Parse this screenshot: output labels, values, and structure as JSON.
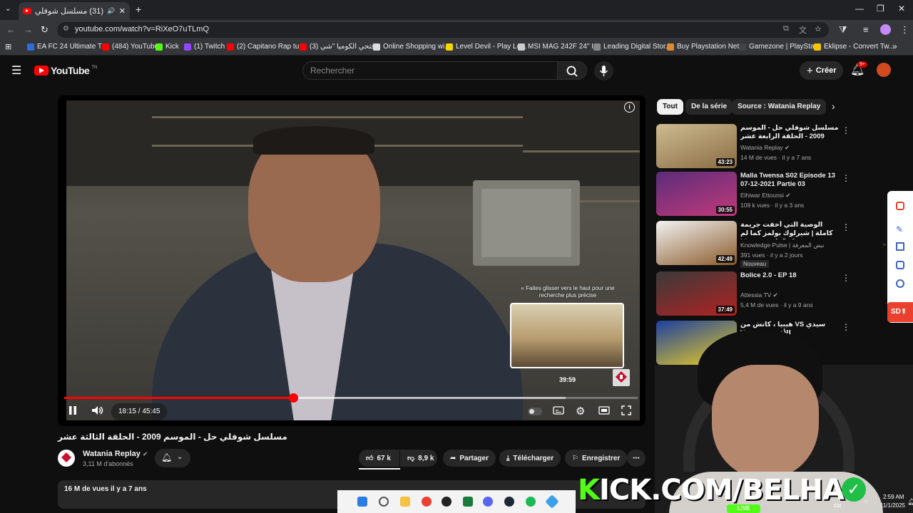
{
  "browser": {
    "tab_title": "(31) مسلسل شوفلي حل - ال...",
    "new_tab": "+",
    "url": "youtube.com/watch?v=RiXeO7uTLmQ",
    "bookmarks": [
      {
        "label": "EA FC 24 Ultimate T...",
        "color": "#2d6cdf"
      },
      {
        "label": "(484) YouTube",
        "color": "#ff0000"
      },
      {
        "label": "Kick",
        "color": "#53fc18"
      },
      {
        "label": "(1) Twitch",
        "color": "#9146ff"
      },
      {
        "label": "(2) Capitano Rap tu...",
        "color": "#ff0000"
      },
      {
        "label": "(3) فتحي الكوميا \"شي...",
        "color": "#ff0000"
      },
      {
        "label": "Online Shopping wi...",
        "color": "#dddddd"
      },
      {
        "label": "Level Devil - Play Le...",
        "color": "#f5d400"
      },
      {
        "label": "MSI MAG 242F 24\" I...",
        "color": "#cccccc"
      },
      {
        "label": "Leading Digital Stor...",
        "color": "#888888"
      },
      {
        "label": "Buy Playstation Net...",
        "color": "#e08a2d"
      },
      {
        "label": "Gamezone | PlaySta...",
        "color": "#444444"
      },
      {
        "label": "Eklipse - Convert Tw...",
        "color": "#f5c400"
      }
    ]
  },
  "youtube": {
    "logo_text": "YouTube",
    "logo_sup": "TN",
    "search_placeholder": "Rechercher",
    "create_label": "Créer",
    "notif_count": "9+"
  },
  "player": {
    "slide_hint": "Faites glisser vers le haut pour une recherche plus précise",
    "hover_time": "39:59",
    "time_display": "18:15 / 45:45",
    "played_fraction": 0.3989,
    "hover_fraction": 0.874
  },
  "video": {
    "title": "مسلسل شوفلي حل - الموسم 2009 - الحلقة الثالثة عشر",
    "channel": "Watania Replay",
    "subscribers": "3,11 M d'abonnés",
    "likes": "67 k",
    "dislikes": "8,9 k",
    "share": "Partager",
    "download": "Télécharger",
    "save": "Enregistrer",
    "description_meta": "16 M de vues  il y a 7 ans"
  },
  "chips": [
    "Tout",
    "De la série",
    "Source : Watania Replay"
  ],
  "recommendations": [
    {
      "title": "مسلسل شوفلي حل - الموسم 2009 - الحلقة الرابعة عشر",
      "channel": "Watania Replay",
      "meta": "14 M de vues · il y a 7 ans",
      "duration": "43:23",
      "new": ""
    },
    {
      "title": "Malla Twensa S02 Episode 13 07-12-2021 Partie 03",
      "channel": "Elhiwar Ettounsi",
      "meta": "108 k vues · il y a 3 ans",
      "duration": "30:55",
      "new": ""
    },
    {
      "title": "الوصية التي أخفت جريمة كاملة | شيرلوك بولمز كما لم تسمعه من قبل (كتاب سوتي) |",
      "channel": "Knowledge Pulse | نبض المعرفة",
      "meta": "391 vues · il y a 2 jours",
      "duration": "42:49",
      "new": "Nouveau"
    },
    {
      "title": "Bolice 2.0 - EP 18",
      "channel": "Attessia TV",
      "meta": "5,4 M de vues · il y a 9 ans",
      "duration": "37:49",
      "new": ""
    },
    {
      "title": "سيدي VS هيبيا ، كاتش من الأفضل ؟ Vinha",
      "channel": "",
      "meta": "",
      "duration": "",
      "new": ""
    }
  ],
  "stream": {
    "kick_prefix": "K",
    "kick_text": "ICK.COM/BELHA",
    "live": "LIVE"
  },
  "tray": {
    "lang": "FR",
    "time": "2:59 AM",
    "date": "11/1/2025"
  }
}
